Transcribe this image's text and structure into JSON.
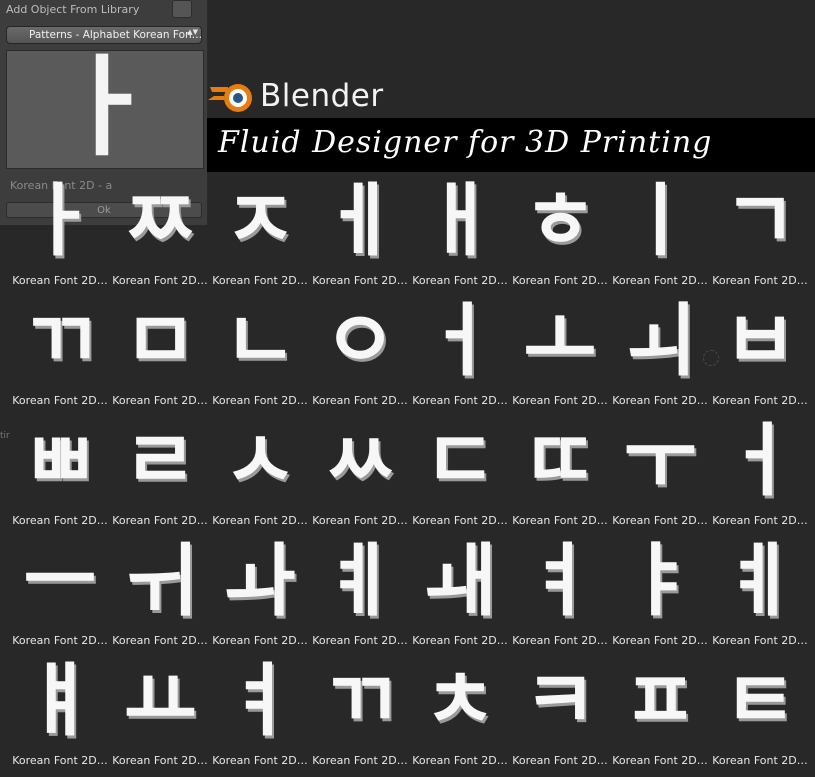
{
  "panel": {
    "title": "Add Object From Library",
    "dropdown_label": "Patterns - Alphabet Korean Fon…",
    "dropdown_arrows": "▲▼",
    "preview_glyph": "ㅏ",
    "object_name": "Korean Font 2D - a",
    "ok_label": "Ok"
  },
  "header": {
    "logo_text": "Blender",
    "banner_text": "Fluid Designer for 3D Printing"
  },
  "grid": {
    "label": "Korean Font 2D…",
    "glyphs": [
      "ㅏ",
      "ㅉ",
      "ㅈ",
      "ㅔ",
      "ㅐ",
      "ㅎ",
      "ㅣ",
      "ㄱ",
      "ㄲ",
      "ㅁ",
      "ㄴ",
      "ㅇ",
      "ㅓ",
      "ㅗ",
      "ㅚ",
      "ㅂ",
      "ㅃ",
      "ㄹ",
      "ㅅ",
      "ㅆ",
      "ㄷ",
      "ㄸ",
      "ㅜ",
      "ㅓ",
      "ㅡ",
      "ㅟ",
      "ㅘ",
      "ㅖ",
      "ㅙ",
      "ㅕ",
      "ㅑ",
      "ㅖ",
      "ㅒ",
      "ㅛ",
      "ㅕ",
      "ㄲ",
      "ㅊ",
      "ㅋ",
      "ㅍ",
      "ㅌ"
    ]
  },
  "side_fragment": "tir",
  "colors": {
    "background": "#282828",
    "panel": "#3d3d3d",
    "banner": "#000000",
    "logo_orange": "#e87d0d",
    "logo_blue": "#265787"
  },
  "icons": [
    "blender-logo-icon",
    "dropdown-arrows-icon"
  ]
}
